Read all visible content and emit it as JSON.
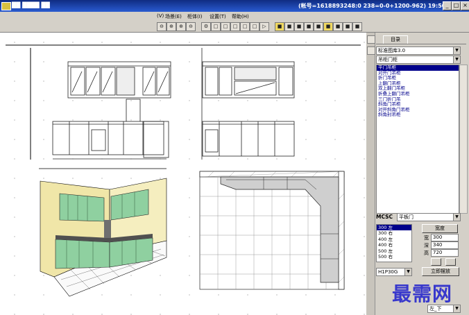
{
  "window": {
    "title": "██ ████ ██",
    "account": "(帐号=1618893248:0 238=0-0+1200-962) 19:50",
    "controls": {
      "minimize": "_",
      "maximize": "□",
      "close": "×"
    }
  },
  "menu": [
    "(V)",
    "场景(E)",
    "柜体(I)",
    "设置(T)",
    "帮助(H)"
  ],
  "toolbar": {
    "buttons": [
      "⊖",
      "⊕",
      "⊕",
      "⊖",
      "⚙",
      "□",
      "□",
      "□",
      "□",
      "□",
      "▷",
      "■",
      "■",
      "■",
      "■",
      "■",
      "■",
      "■",
      "■",
      "■"
    ],
    "icons": [
      "zoom-out-icon",
      "zoom-in-icon",
      "zoom-window-icon",
      "zoom-all-icon",
      "settings-icon",
      "select-icon",
      "cabinet-icon",
      "door-icon",
      "box-icon",
      "shelf-icon",
      "play-icon",
      "yellow-icon",
      "camera-icon",
      "view-icon",
      "stair-icon",
      "arrow-icon",
      "render-icon",
      "color-icon",
      "light-icon",
      "export-icon"
    ]
  },
  "panel": {
    "tab_label": "目录",
    "library_combo": "标准图库3.0",
    "category_combo": "吊柜门柜",
    "items": [
      "平门吊柜",
      "对开门吊柜",
      "折门吊柜",
      "上翻门吊柜",
      "双上翻门吊柜",
      "折叠上翻门吊柜",
      "三门折门吊",
      "斜角门吊柜",
      "对开斜角门吊柜",
      "斜角封吊柜"
    ],
    "selected_item_index": 0,
    "mcsc_label": "MCSC",
    "door_type": "平板门",
    "sizes": [
      "300 左",
      "300 右",
      "400 左",
      "400 右",
      "500 左",
      "500 右"
    ],
    "selected_size_index": 0,
    "width_button": "宽度",
    "fields": [
      {
        "label": "宽",
        "value": "300"
      },
      {
        "label": "深",
        "value": "340"
      },
      {
        "label": "高",
        "value": "720"
      }
    ],
    "model_combo": "H1P30G",
    "place_button": "立即摆放",
    "position_combo": "左_下"
  },
  "watermark": "最需网",
  "colors": {
    "cabinet_green": "#8fd0a0",
    "wall_yellow": "#f0e6a8",
    "titlebar": "#1a3e9e",
    "selection": "#00008b"
  }
}
